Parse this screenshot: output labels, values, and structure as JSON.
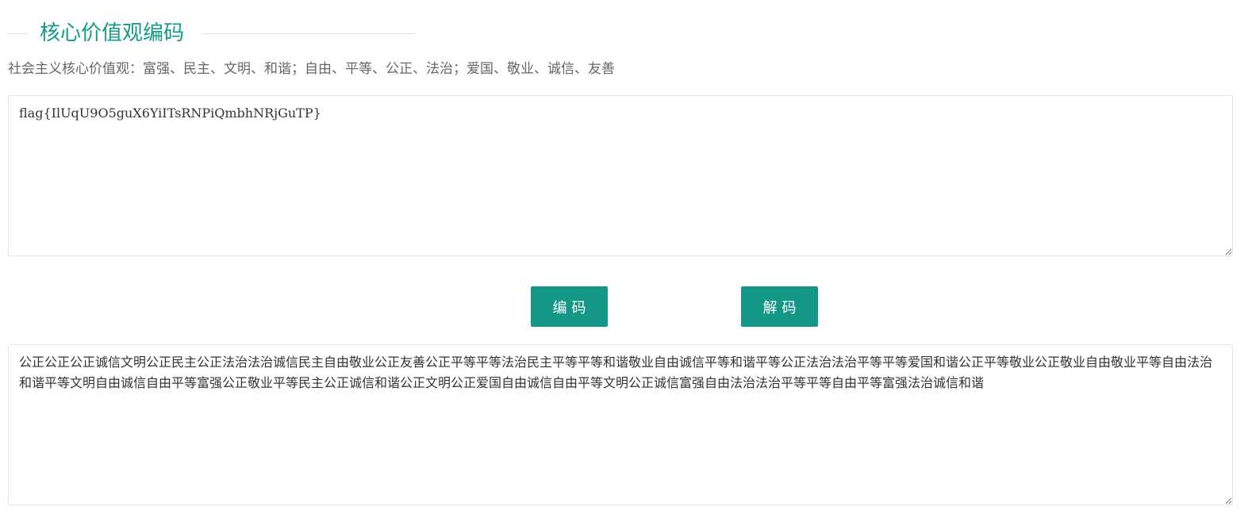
{
  "header": {
    "title": "核心价值观编码",
    "subtitle": "社会主义核心价值观：富强、民主、文明、和谐；自由、平等、公正、法治；爱国、敬业、诚信、友善"
  },
  "input": {
    "value": "flag{IlUqU9O5guX6YiITsRNPiQmbhNRjGuTP}",
    "placeholder": ""
  },
  "buttons": {
    "encode_label": "编码",
    "decode_label": "解码"
  },
  "output": {
    "value": "公正公正公正诚信文明公正民主公正法治法治诚信民主自由敬业公正友善公正平等平等法治民主平等平等和谐敬业自由诚信平等和谐平等公正法治法治平等平等爱国和谐公正平等敬业公正敬业自由敬业平等自由法治和谐平等文明自由诚信自由平等富强公正敬业平等民主公正诚信和谐公正文明公正爱国自由诚信自由平等文明公正诚信富强自由法治法治平等平等自由平等富强法治诚信和谐",
    "placeholder": ""
  },
  "colors": {
    "accent": "#149787",
    "title": "#149b87",
    "border": "#e4e4e4"
  }
}
